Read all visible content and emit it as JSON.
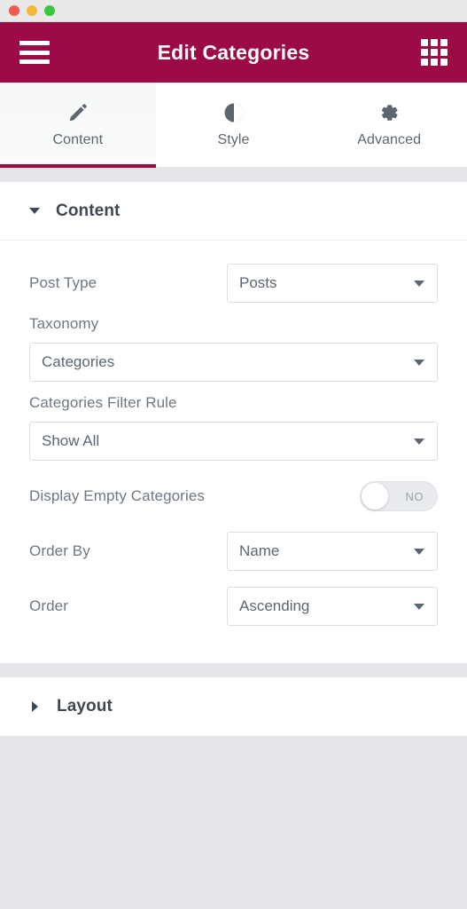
{
  "window": {
    "traffic_lights": [
      "close",
      "minimize",
      "zoom"
    ]
  },
  "header": {
    "title": "Edit Categories",
    "menu_icon": "hamburger-icon",
    "apps_icon": "grid-apps-icon",
    "background_color": "#9c0b46"
  },
  "tabs": [
    {
      "label": "Content",
      "icon": "pencil-icon",
      "active": true
    },
    {
      "label": "Style",
      "icon": "contrast-icon",
      "active": false
    },
    {
      "label": "Advanced",
      "icon": "gear-icon",
      "active": false
    }
  ],
  "sections": [
    {
      "title": "Content",
      "expanded": true,
      "controls": {
        "post_type": {
          "label": "Post Type",
          "value": "Posts",
          "layout": "inline"
        },
        "taxonomy": {
          "label": "Taxonomy",
          "value": "Categories",
          "layout": "stacked"
        },
        "categories_filter_rule": {
          "label": "Categories Filter Rule",
          "value": "Show All",
          "layout": "stacked"
        },
        "display_empty_categories": {
          "label": "Display Empty Categories",
          "value": "NO",
          "layout": "toggle"
        },
        "order_by": {
          "label": "Order By",
          "value": "Name",
          "layout": "inline"
        },
        "order": {
          "label": "Order",
          "value": "Ascending",
          "layout": "inline"
        }
      }
    },
    {
      "title": "Layout",
      "expanded": false
    }
  ]
}
